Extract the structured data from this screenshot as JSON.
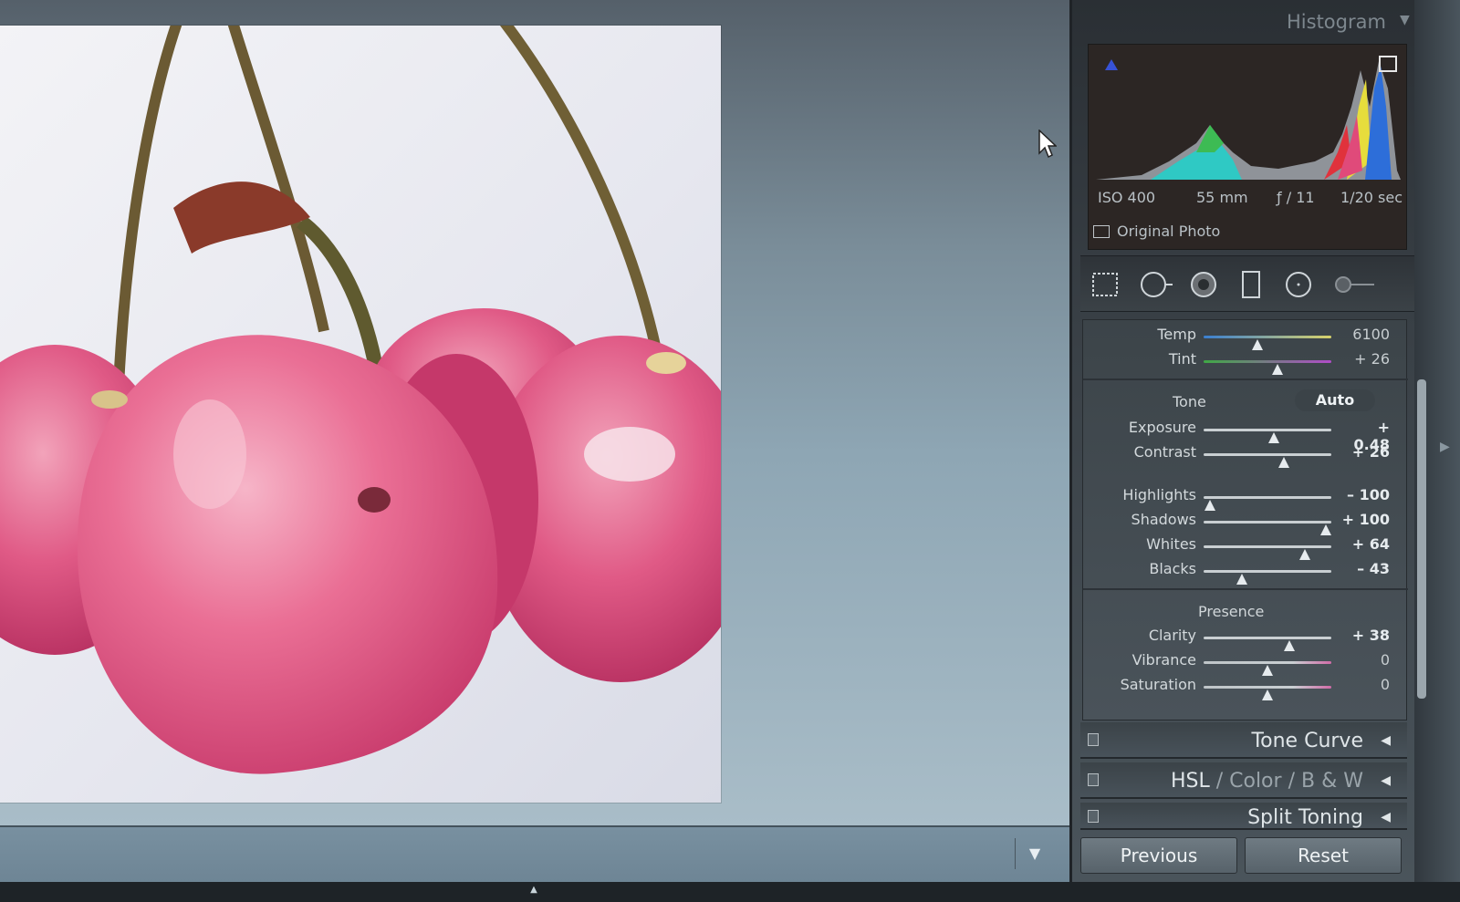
{
  "histogram": {
    "title": "Histogram",
    "iso": "ISO 400",
    "focal_length": "55 mm",
    "aperture": "ƒ / 11",
    "shutter": "1/20 sec",
    "original_photo_label": "Original Photo"
  },
  "basic": {
    "temp": {
      "label": "Temp",
      "value": "6100",
      "level": 0.42
    },
    "tint": {
      "label": "Tint",
      "value": "+ 26",
      "level": 0.58
    },
    "tone_label": "Tone",
    "auto_label": "Auto",
    "exposure": {
      "label": "Exposure",
      "value": "+ 0.48",
      "level": 0.55
    },
    "contrast": {
      "label": "Contrast",
      "value": "+ 26",
      "level": 0.63
    },
    "highlights": {
      "label": "Highlights",
      "value": "– 100",
      "level": 0.05
    },
    "shadows": {
      "label": "Shadows",
      "value": "+ 100",
      "level": 0.96
    },
    "whites": {
      "label": "Whites",
      "value": "+ 64",
      "level": 0.79
    },
    "blacks": {
      "label": "Blacks",
      "value": "– 43",
      "level": 0.3
    },
    "presence_label": "Presence",
    "clarity": {
      "label": "Clarity",
      "value": "+ 38",
      "level": 0.67
    },
    "vibrance": {
      "label": "Vibrance",
      "value": "0",
      "level": 0.5
    },
    "saturation": {
      "label": "Saturation",
      "value": "0",
      "level": 0.5
    }
  },
  "panels": {
    "tone_curve": "Tone Curve",
    "hsl": "HSL",
    "color": "Color",
    "bw": "B & W",
    "separator": "/",
    "split_toning": "Split Toning"
  },
  "buttons": {
    "previous": "Previous",
    "reset": "Reset"
  },
  "colors": {
    "panel_bg": "#3c4449",
    "photo_bg": "#eef0f4",
    "cherry": "#e05a86"
  },
  "icons": [
    "crop-icon",
    "spot-removal-icon",
    "red-eye-icon",
    "graduated-filter-icon",
    "radial-filter-icon",
    "adjustment-brush-icon",
    "histogram-caret-icon",
    "chevron-left-icon",
    "chevron-down-icon",
    "cursor-icon"
  ]
}
